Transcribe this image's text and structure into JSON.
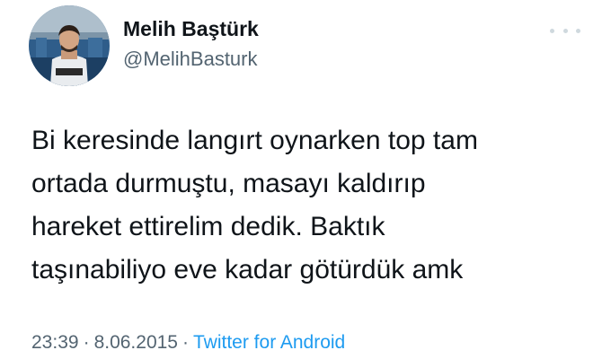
{
  "tweet": {
    "author": {
      "display_name": "Melih Baştürk",
      "handle": "@MelihBasturk"
    },
    "more_icon": "more-horizontal-icon",
    "text_lines": [
      "Bi keresinde langırt oynarken top tam",
      "ortada durmuştu, masayı kaldırıp",
      "hareket ettirelim dedik. Baktık",
      "taşınabiliyo eve kadar götürdük amk"
    ],
    "time": "23:39",
    "separator": "·",
    "date": "8.06.2015",
    "source": "Twitter for Android"
  },
  "colors": {
    "text": "#0f1419",
    "secondary": "#536471",
    "link": "#1d9bf0",
    "more_dots": "#cfd9de"
  }
}
